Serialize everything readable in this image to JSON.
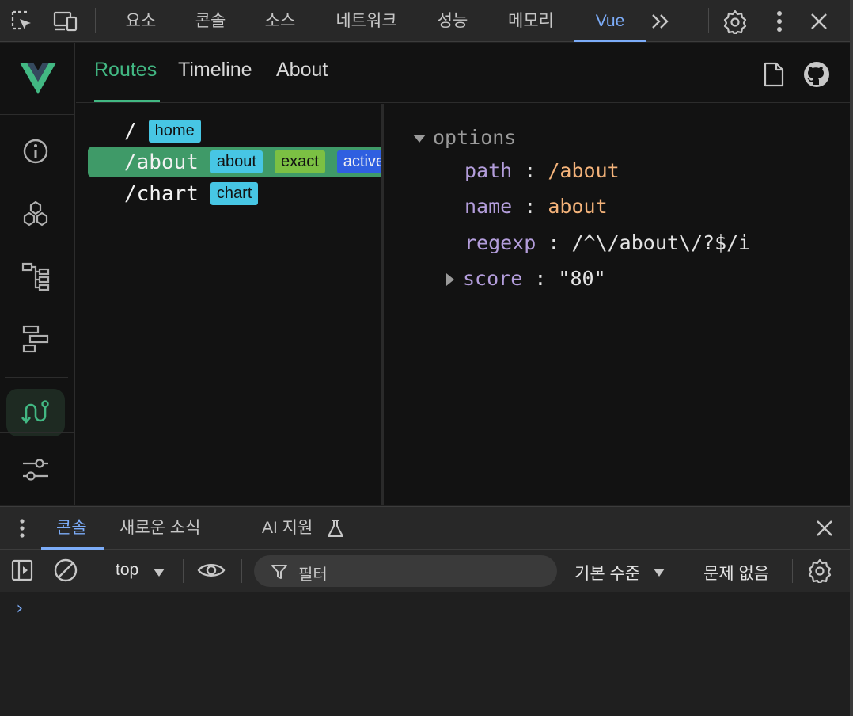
{
  "devtools_tabs": [
    "요소",
    "콘솔",
    "소스",
    "네트워크",
    "성능",
    "메모리",
    "Vue"
  ],
  "active_tab": "Vue",
  "colors": {
    "accent_blue": "#7cacf8",
    "vue_green": "#42b883",
    "selected_route": "#3f9a68",
    "tag_cyan": "#47c6e4",
    "tag_lime": "#7bc043",
    "tag_blue": "#2f5fe0"
  },
  "vue": {
    "tabs": [
      "Routes",
      "Timeline",
      "About"
    ],
    "active_tab": "Routes",
    "routes": [
      {
        "path": "/",
        "tags": [
          {
            "text": "home",
            "color": "cyan"
          }
        ]
      },
      {
        "path": "/about",
        "selected": true,
        "tags": [
          {
            "text": "about",
            "color": "cyan"
          },
          {
            "text": "exact",
            "color": "lime"
          },
          {
            "text": "active",
            "color": "blue"
          }
        ]
      },
      {
        "path": "/chart",
        "tags": [
          {
            "text": "chart",
            "color": "cyan"
          }
        ]
      }
    ],
    "details": {
      "section": "options",
      "path_key": "path",
      "path_val": "/about",
      "name_key": "name",
      "name_val": "about",
      "regexp_key": "regexp",
      "regexp_val": "/^\\/about\\/?$/i",
      "score_key": "score",
      "score_val": "\"80\""
    }
  },
  "drawer": {
    "tabs": [
      "콘솔",
      "새로운 소식",
      "AI 지원"
    ],
    "active_tab": "콘솔",
    "context": "top",
    "filter_placeholder": "필터",
    "level": "기본 수준",
    "issues": "문제 없음",
    "prompt": "›"
  }
}
